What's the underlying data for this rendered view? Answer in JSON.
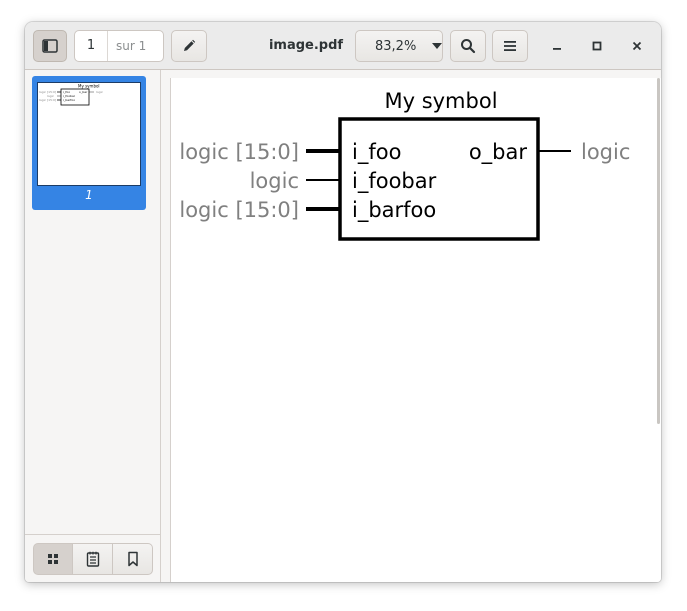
{
  "toolbar": {
    "page_number": "1",
    "page_total": "sur 1",
    "document_title": "image.pdf",
    "zoom_value": "83,2%"
  },
  "sidebar": {
    "thumbnail_label": "1",
    "tabs": [
      "thumbnails-icon",
      "document-icon",
      "bookmark-icon"
    ]
  },
  "document": {
    "symbol_title": "My symbol",
    "ports_in": [
      {
        "type": "logic [15:0]",
        "name": "i_foo"
      },
      {
        "type": "logic",
        "name": "i_foobar"
      },
      {
        "type": "logic [15:0]",
        "name": "i_barfoo"
      }
    ],
    "ports_out": [
      {
        "type": "logic",
        "name": "o_bar"
      }
    ]
  },
  "icons": {
    "sidebar_toggle": "sidebar-toggle-icon",
    "annotate": "pencil-icon",
    "search": "search-icon",
    "menu": "hamburger-menu-icon",
    "minimize": "minimize-icon",
    "maximize": "maximize-icon",
    "close": "close-icon"
  }
}
